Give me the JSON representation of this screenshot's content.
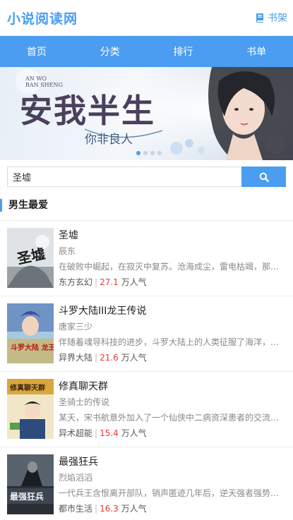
{
  "header": {
    "logo": "小说阅读网",
    "shelf_label": "书架",
    "shelf_icon": "book-icon"
  },
  "nav": {
    "items": [
      {
        "label": "首页"
      },
      {
        "label": "分类"
      },
      {
        "label": "排行"
      },
      {
        "label": "书单"
      }
    ]
  },
  "banner": {
    "small_text_1": "AN WO",
    "small_text_2": "BAN SHENG",
    "title_main": "安我半生",
    "title_sub": "你非良人",
    "dot_count": 4,
    "active_dot": 0
  },
  "search": {
    "value": "圣墟",
    "icon": "search-icon"
  },
  "section": {
    "title": "男生最爱"
  },
  "books": [
    {
      "title": "圣墟",
      "author": "辰东",
      "desc": "在破败中崛起，在寂灭中复苏。沧海成尘，雷电枯竭，那一缕幽雾又一次临近大地，世间的枷锁被打开了，一个全新的世界就此揭开神秘的一角……",
      "category": "东方玄幻",
      "popularity": "27.1",
      "pop_unit": "万人气",
      "cover_text": "圣墟"
    },
    {
      "title": "斗罗大陆III龙王传说",
      "author": "唐家三少",
      "desc": "伴随着魂导科技的进步，斗罗大陆上的人类征服了海洋，又发现了两片大陆。",
      "category": "异界大陆",
      "popularity": "21.6",
      "pop_unit": "万人气",
      "cover_text": "斗罗大陆 龙王传说"
    },
    {
      "title": "修真聊天群",
      "author": "圣骑士的传说",
      "desc": "某天，宋书航意外加入了一个仙侠中二病资深患者的交流群，里面的群友们都以道友相称。",
      "category": "异术超能",
      "popularity": "15.4",
      "pop_unit": "万人气",
      "cover_text": "修真聊天群"
    },
    {
      "title": "最强狂兵",
      "author": "烈焰滔滔",
      "desc": "一代兵王含恨离开部队，销声匿迹几年后，逆天强者强势回归。",
      "category": "都市生活",
      "popularity": "16.3",
      "pop_unit": "万人气",
      "cover_text": "最强狂兵"
    }
  ],
  "colors": {
    "accent": "#4a9df0",
    "popularity": "#e4393c"
  }
}
